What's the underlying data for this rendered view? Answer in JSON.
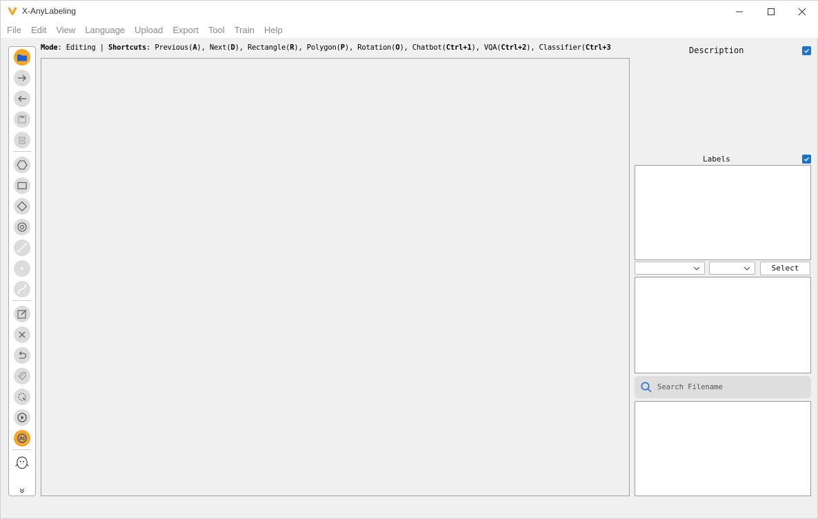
{
  "window": {
    "title": "X-AnyLabeling",
    "logo_icon": "x-anylabeling-logo-icon",
    "accent_color": "#f5a623"
  },
  "menu": [
    "File",
    "Edit",
    "View",
    "Language",
    "Upload",
    "Export",
    "Tool",
    "Train",
    "Help"
  ],
  "toolbar": {
    "tools": [
      "open-folder-icon",
      "next-image-icon",
      "previous-image-icon",
      "save-icon",
      "delete-icon",
      "polygon-icon",
      "rectangle-icon",
      "rotation-icon",
      "circle-icon",
      "line-icon",
      "point-icon",
      "linestrip-icon",
      "edit-icon",
      "close-shape-icon",
      "undo-icon",
      "duplicate-icon",
      "brightness-icon",
      "run-icon",
      "ai-icon",
      "chatbot-icon",
      "expand-more-icon"
    ]
  },
  "modebar": {
    "mode_label": "Mode",
    "mode_value": ": Editing | ",
    "shortcuts_label": "Shortcuts",
    "shortcuts_prefix": ": Previous(",
    "k_prev": "A",
    "s1": "), Next(",
    "k_next": "D",
    "s2": "), Rectangle(",
    "k_rect": "R",
    "s3": "), Polygon(",
    "k_poly": "P",
    "s4": "), Rotation(",
    "k_rot": "O",
    "s5": "), Chatbot(",
    "k_chat": "Ctrl+1",
    "s6": "), VQA(",
    "k_vqa": "Ctrl+2",
    "s7": "), Classifier(",
    "k_cls": "Ctrl+3"
  },
  "right_panel": {
    "description_title": "Description",
    "labels_title": "Labels",
    "select_label": "Select",
    "search_placeholder": "Search Filename"
  }
}
